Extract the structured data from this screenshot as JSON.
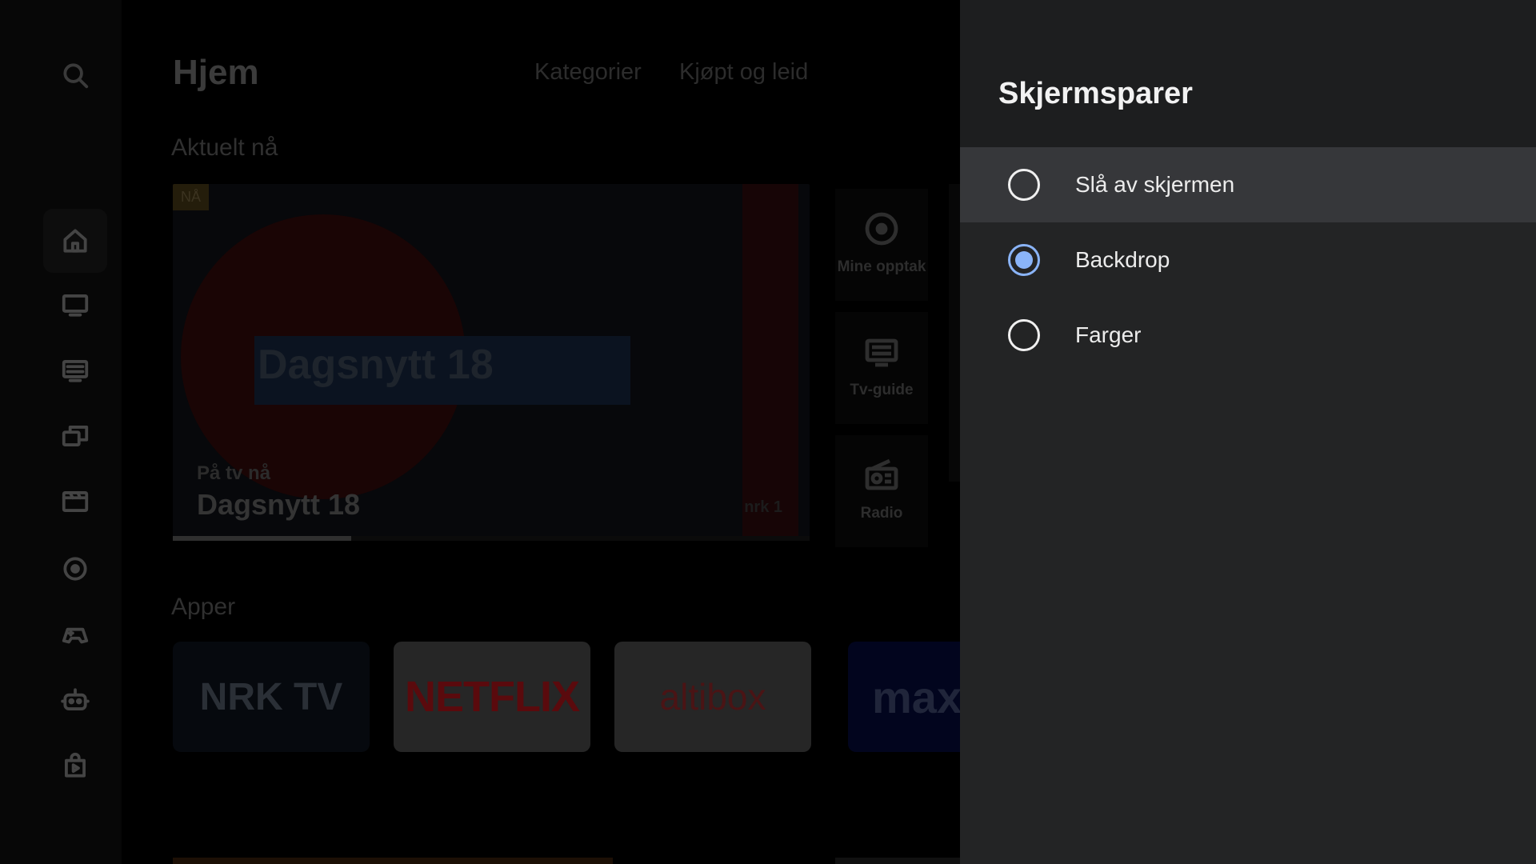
{
  "home": {
    "title": "Hjem",
    "tabs": [
      "Kategorier",
      "Kjøpt og leid"
    ],
    "rail_icons": [
      "search-icon",
      "home-icon",
      "tv-icon",
      "tv-guide-icon",
      "multi-screen-icon",
      "film-icon",
      "record-icon",
      "gamepad-icon",
      "robot-icon",
      "play-store-icon"
    ],
    "current_section": "Aktuelt nå",
    "hero": {
      "badge": "NÅ",
      "logo_text": "Dagsnytt 18",
      "subtitle": "På tv nå",
      "title": "Dagsnytt 18",
      "channel": "nrk 1",
      "progress_percent": 28
    },
    "shortcuts": [
      {
        "label": "Mine opptak",
        "icon": "record-icon"
      },
      {
        "label": "Tv-guide",
        "icon": "tv-guide-icon"
      },
      {
        "label": "Radio",
        "icon": "radio-icon"
      }
    ],
    "apps_section": "Apper",
    "apps": [
      {
        "name": "NRK TV",
        "logo_text": "NRK TV",
        "bg": "#06090e",
        "fg": "#2a2f36"
      },
      {
        "name": "Netflix",
        "logo_text": "NETFLIX",
        "bg": "#262626",
        "fg": "#5a0a0d"
      },
      {
        "name": "Altibox",
        "logo_text": "altibox",
        "bg": "#262626",
        "fg": "#4a1415"
      },
      {
        "name": "Max",
        "logo_text": "max",
        "bg": "#02051e",
        "fg": "#20253a"
      }
    ]
  },
  "panel": {
    "title": "Skjermsparer",
    "options": [
      {
        "label": "Slå av skjermen",
        "checked": false,
        "focused": true
      },
      {
        "label": "Backdrop",
        "checked": true,
        "focused": false
      },
      {
        "label": "Farger",
        "checked": false,
        "focused": false
      }
    ],
    "accent_color": "#8ab4f8"
  }
}
